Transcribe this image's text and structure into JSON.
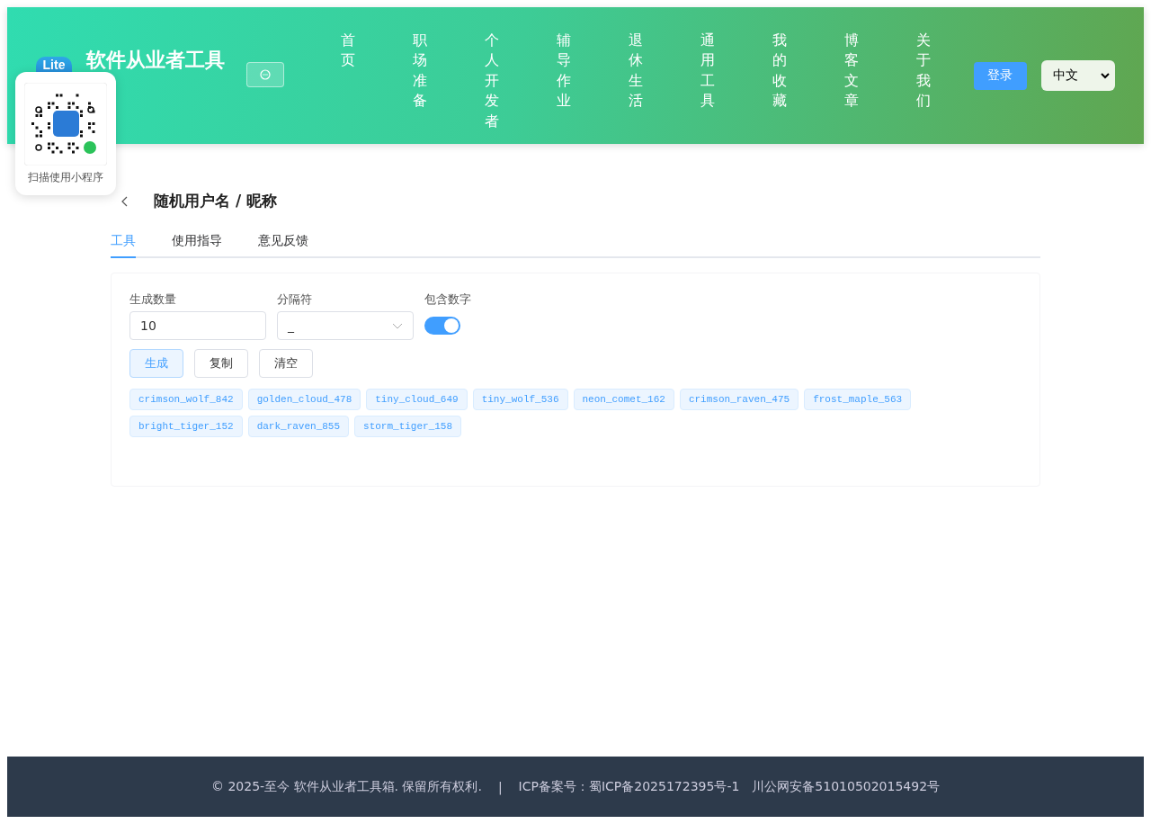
{
  "header": {
    "logo_text": "Lite",
    "title": "软件从业者工具",
    "nav": [
      "首页",
      "职场准备",
      "个人开发者",
      "辅导作业",
      "退休生活",
      "通用工具",
      "我的收藏",
      "博客文章",
      "关于我们"
    ],
    "login": "登录",
    "language": "中文"
  },
  "qr_popup": {
    "caption": "扫描使用小程序"
  },
  "page": {
    "title": "随机用户名 / 昵称",
    "tabs": [
      {
        "label": "工具",
        "selected": true
      },
      {
        "label": "使用指导",
        "selected": false
      },
      {
        "label": "意见反馈",
        "selected": false
      }
    ],
    "fields": [
      {
        "kind": "input",
        "label": "生成数量",
        "value": "10"
      },
      {
        "kind": "select",
        "label": "分隔符",
        "value": "_"
      },
      {
        "kind": "switch",
        "label": "包含数字",
        "on": true
      }
    ],
    "buttons": [
      {
        "label": "生成",
        "primary": true
      },
      {
        "label": "复制",
        "primary": false
      },
      {
        "label": "清空",
        "primary": false
      }
    ],
    "results": [
      "crimson_wolf_842",
      "golden_cloud_478",
      "tiny_cloud_649",
      "tiny_wolf_536",
      "neon_comet_162",
      "crimson_raven_475",
      "frost_maple_563",
      "bright_tiger_152",
      "dark_raven_855",
      "storm_tiger_158"
    ]
  },
  "footer": {
    "copyright": "© 2025-至今 软件从业者工具箱. 保留所有权利.",
    "separator": "|",
    "icp": "ICP备案号：蜀ICP备2025172395号-1",
    "police": "川公网安备51010502015492号"
  }
}
